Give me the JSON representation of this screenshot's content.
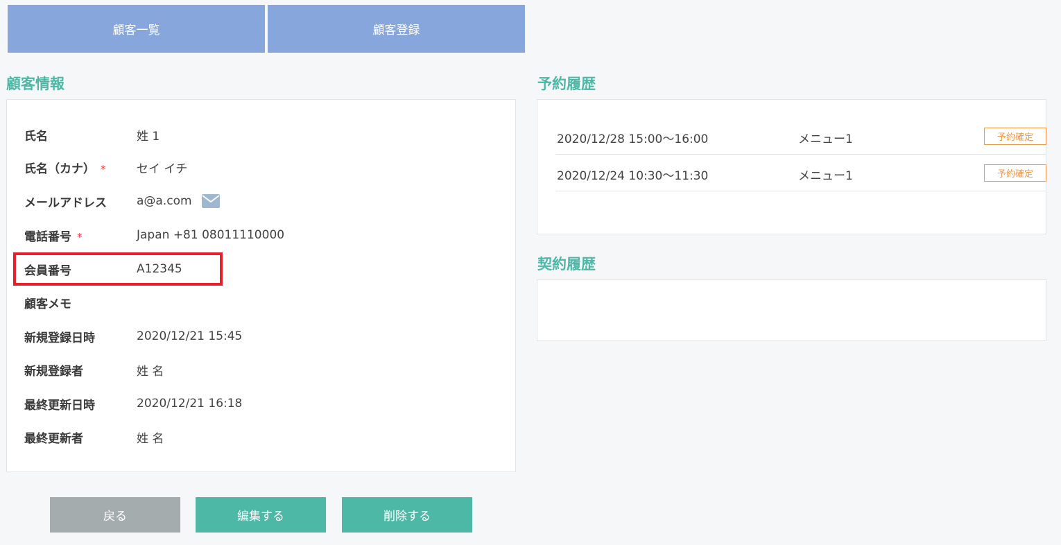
{
  "nav": {
    "customer_list": "顧客一覧",
    "customer_register": "顧客登録"
  },
  "customer_info": {
    "title": "顧客情報",
    "fields": [
      {
        "label": "氏名",
        "value": "姓 1",
        "required": false
      },
      {
        "label": "氏名（カナ）",
        "value": "セイ イチ",
        "required": true
      },
      {
        "label": "メールアドレス",
        "value": "a@a.com",
        "required": false,
        "icon": "envelope-icon"
      },
      {
        "label": "電話番号",
        "value": "Japan +81 08011110000",
        "required": true
      },
      {
        "label": "会員番号",
        "value": "A12345",
        "required": false,
        "highlighted": true
      },
      {
        "label": "顧客メモ",
        "value": "",
        "required": false
      },
      {
        "label": "新規登録日時",
        "value": "2020/12/21 15:45",
        "required": false
      },
      {
        "label": "新規登録者",
        "value": "姓 名",
        "required": false
      },
      {
        "label": "最終更新日時",
        "value": "2020/12/21 16:18",
        "required": false
      },
      {
        "label": "最終更新者",
        "value": "姓 名",
        "required": false
      }
    ],
    "required_mark": "*"
  },
  "reservation_history": {
    "title": "予約履歴",
    "items": [
      {
        "datetime": "2020/12/28 15:00～16:00",
        "menu": "メニュー1",
        "status": "予約確定"
      },
      {
        "datetime": "2020/12/24 10:30～11:30",
        "menu": "メニュー1",
        "status": "予約確定"
      }
    ]
  },
  "contract_history": {
    "title": "契約履歴"
  },
  "actions": {
    "back": "戻る",
    "edit": "編集する",
    "delete": "削除する"
  },
  "colors": {
    "nav_button": "#87a6dc",
    "accent": "#4db8a6",
    "back_button": "#a5acad",
    "badge": "#f39a4a",
    "highlight": "#e5202a"
  }
}
